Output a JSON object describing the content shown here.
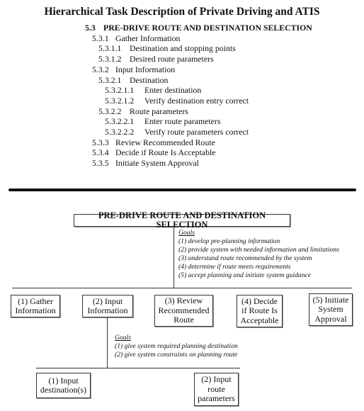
{
  "title": "Hierarchical Task Description of Private Driving and ATIS",
  "outline": [
    {
      "num": "5.3",
      "text": "PRE-DRIVE ROUTE AND DESTINATION SELECTION",
      "level": 0
    },
    {
      "num": "5.3.1",
      "text": "Gather Information",
      "level": 1
    },
    {
      "num": "5.3.1.1",
      "text": "Destination and stopping points",
      "level": 2
    },
    {
      "num": "5.3.1.2",
      "text": "Desired route parameters",
      "level": 2
    },
    {
      "num": "5.3.2",
      "text": "Input Information",
      "level": 1
    },
    {
      "num": "5.3.2.1",
      "text": "Destination",
      "level": 2
    },
    {
      "num": "5.3.2.1.1",
      "text": "Enter destination",
      "level": 3
    },
    {
      "num": "5.3.2.1.2",
      "text": "Verify destination entry correct",
      "level": 3
    },
    {
      "num": "5.3.2.2",
      "text": "Route parameters",
      "level": 2
    },
    {
      "num": "5.3.2.2.1",
      "text": "Enter route parameters",
      "level": 3
    },
    {
      "num": "5.3.2.2.2",
      "text": "Verify route parameters correct",
      "level": 3
    },
    {
      "num": "5.3.3",
      "text": "Review Recommended Route",
      "level": 1
    },
    {
      "num": "5.3.4",
      "text": "Decide if Route Is Acceptable",
      "level": 1
    },
    {
      "num": "5.3.5",
      "text": "Initiate System Approval",
      "level": 1
    }
  ],
  "diagram": {
    "root": {
      "label": "PRE-DRIVE ROUTE AND DESTINATION SELECTION",
      "goals_heading": "Goals",
      "goals": [
        "(1) develop pre-planning information",
        "(2) provide system with needed information and limitations",
        "(3) understand route recommended by the system",
        "(4) determine if route meets requirements",
        "(5) accept planning and initiate system guidance"
      ]
    },
    "children": [
      {
        "lines": [
          "(1) Gather",
          "Information"
        ]
      },
      {
        "lines": [
          "(2) Input",
          "Information"
        ]
      },
      {
        "lines": [
          "(3) Review",
          "Recommended",
          "Route"
        ]
      },
      {
        "lines": [
          "(4) Decide",
          "if Route Is",
          "Acceptable"
        ]
      },
      {
        "lines": [
          "(5) Initiate",
          "System",
          "Approval"
        ]
      }
    ],
    "input_info": {
      "goals_heading": "Goals",
      "goals": [
        "(1) give system required planning destination",
        "(2) give system constraints on planning route"
      ],
      "children": [
        {
          "lines": [
            "(1) Input",
            "destination(s)"
          ]
        },
        {
          "lines": [
            "(2) Input",
            "route",
            "parameters"
          ]
        }
      ]
    }
  }
}
